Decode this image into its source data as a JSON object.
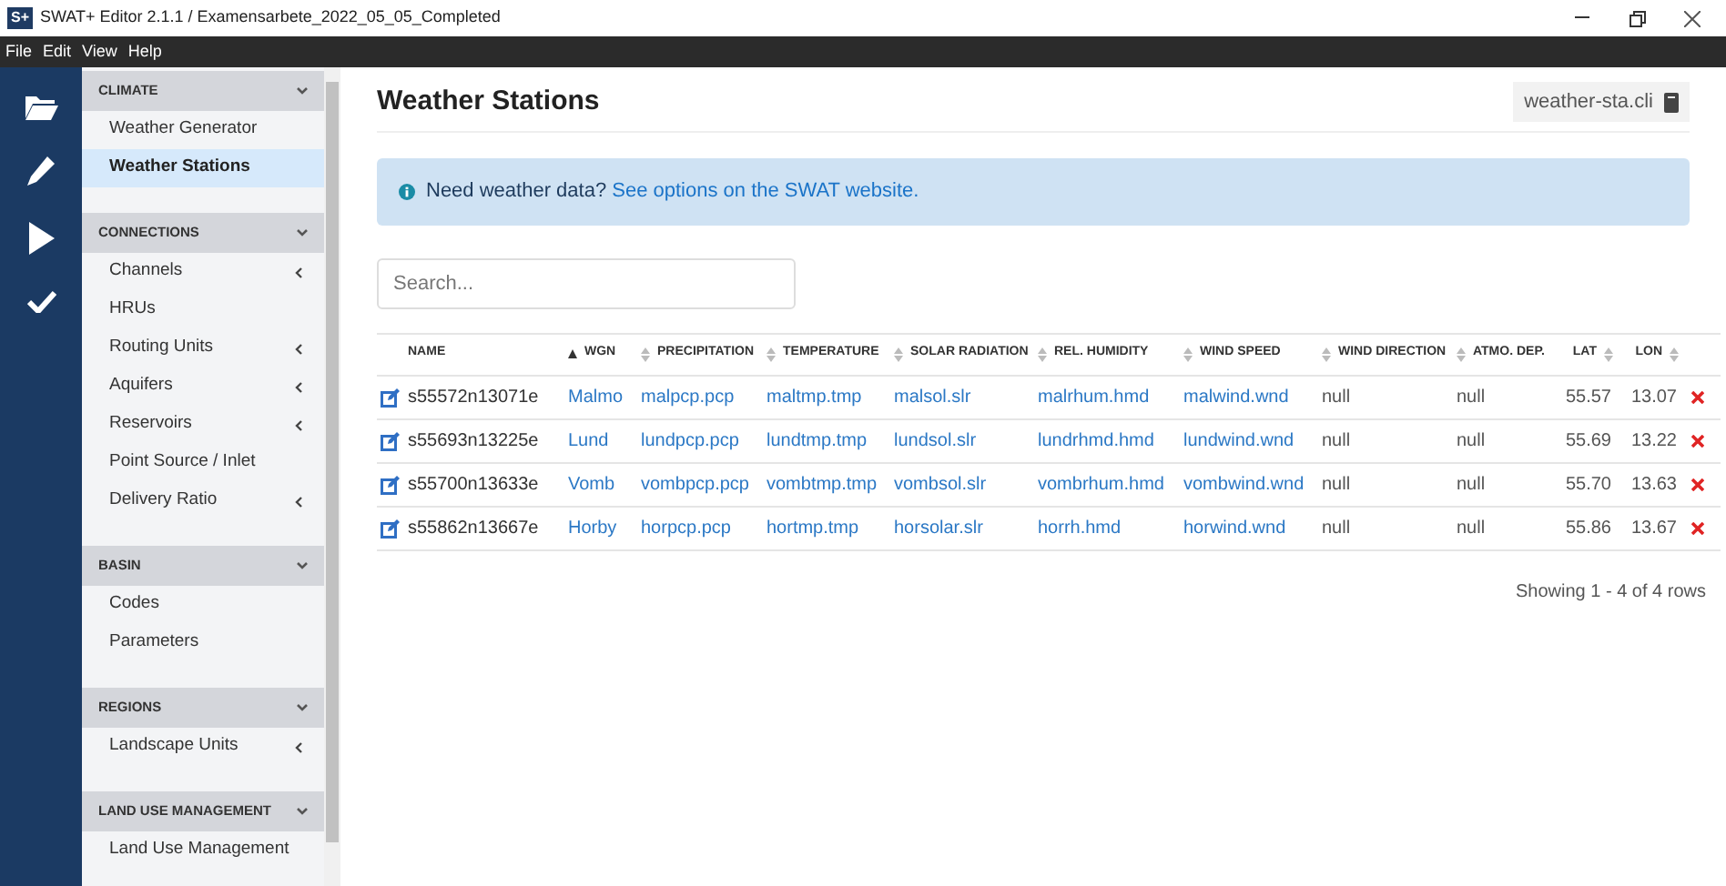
{
  "window": {
    "title": "SWAT+ Editor 2.1.1 / Examensarbete_2022_05_05_Completed",
    "app_badge": "S+"
  },
  "menu": [
    "File",
    "Edit",
    "View",
    "Help"
  ],
  "sidebar": {
    "sections": [
      {
        "title": "CLIMATE",
        "expanded": true,
        "items": [
          {
            "label": "Weather Generator",
            "selected": false,
            "has_children": false
          },
          {
            "label": "Weather Stations",
            "selected": true,
            "has_children": false
          }
        ]
      },
      {
        "title": "CONNECTIONS",
        "expanded": true,
        "items": [
          {
            "label": "Channels",
            "selected": false,
            "has_children": true
          },
          {
            "label": "HRUs",
            "selected": false,
            "has_children": false
          },
          {
            "label": "Routing Units",
            "selected": false,
            "has_children": true
          },
          {
            "label": "Aquifers",
            "selected": false,
            "has_children": true
          },
          {
            "label": "Reservoirs",
            "selected": false,
            "has_children": true
          },
          {
            "label": "Point Source / Inlet",
            "selected": false,
            "has_children": false
          },
          {
            "label": "Delivery Ratio",
            "selected": false,
            "has_children": true
          }
        ]
      },
      {
        "title": "BASIN",
        "expanded": true,
        "items": [
          {
            "label": "Codes",
            "selected": false,
            "has_children": false
          },
          {
            "label": "Parameters",
            "selected": false,
            "has_children": false
          }
        ]
      },
      {
        "title": "REGIONS",
        "expanded": true,
        "items": [
          {
            "label": "Landscape Units",
            "selected": false,
            "has_children": true
          }
        ]
      },
      {
        "title": "LAND USE MANAGEMENT",
        "expanded": true,
        "items": [
          {
            "label": "Land Use Management",
            "selected": false,
            "has_children": false
          }
        ]
      }
    ]
  },
  "page": {
    "title": "Weather Stations",
    "file_badge": "weather-sta.cli",
    "alert": {
      "text": "Need weather data?",
      "link": "See options on the SWAT website."
    },
    "search": {
      "placeholder": "Search..."
    },
    "table": {
      "columns": [
        {
          "label": "NAME",
          "kind": "text",
          "sortable": false
        },
        {
          "label": "WGN",
          "kind": "link",
          "sortable": true,
          "sorted": true
        },
        {
          "label": "PRECIPITATION",
          "kind": "link",
          "sortable": true,
          "sorted": false
        },
        {
          "label": "TEMPERATURE",
          "kind": "link",
          "sortable": true,
          "sorted": false
        },
        {
          "label": "SOLAR RADIATION",
          "kind": "link",
          "sortable": true,
          "sorted": false
        },
        {
          "label": "REL. HUMIDITY",
          "kind": "link",
          "sortable": true,
          "sorted": false
        },
        {
          "label": "WIND SPEED",
          "kind": "link",
          "sortable": true,
          "sorted": false
        },
        {
          "label": "WIND DIRECTION",
          "kind": "plain",
          "sortable": true,
          "sorted": false
        },
        {
          "label": "ATMO. DEP.",
          "kind": "plain",
          "sortable": true,
          "sorted": false
        },
        {
          "label": "LAT",
          "kind": "number",
          "sortable": true,
          "sorted": false
        },
        {
          "label": "LON",
          "kind": "number",
          "sortable": true,
          "sorted": false
        }
      ],
      "rows": [
        [
          "s55572n13071e",
          "Malmo",
          "malpcp.pcp",
          "maltmp.tmp",
          "malsol.slr",
          "malrhum.hmd",
          "malwind.wnd",
          "null",
          "null",
          "55.57",
          "13.07"
        ],
        [
          "s55693n13225e",
          "Lund",
          "lundpcp.pcp",
          "lundtmp.tmp",
          "lundsol.slr",
          "lundrhmd.hmd",
          "lundwind.wnd",
          "null",
          "null",
          "55.69",
          "13.22"
        ],
        [
          "s55700n13633e",
          "Vomb",
          "vombpcp.pcp",
          "vombtmp.tmp",
          "vombsol.slr",
          "vombrhum.hmd",
          "vombwind.wnd",
          "null",
          "null",
          "55.70",
          "13.63"
        ],
        [
          "s55862n13667e",
          "Horby",
          "horpcp.pcp",
          "hortmp.tmp",
          "horsolar.slr",
          "horrh.hmd",
          "horwind.wnd",
          "null",
          "null",
          "55.86",
          "13.67"
        ]
      ],
      "footer": "Showing 1 - 4 of 4 rows"
    }
  }
}
